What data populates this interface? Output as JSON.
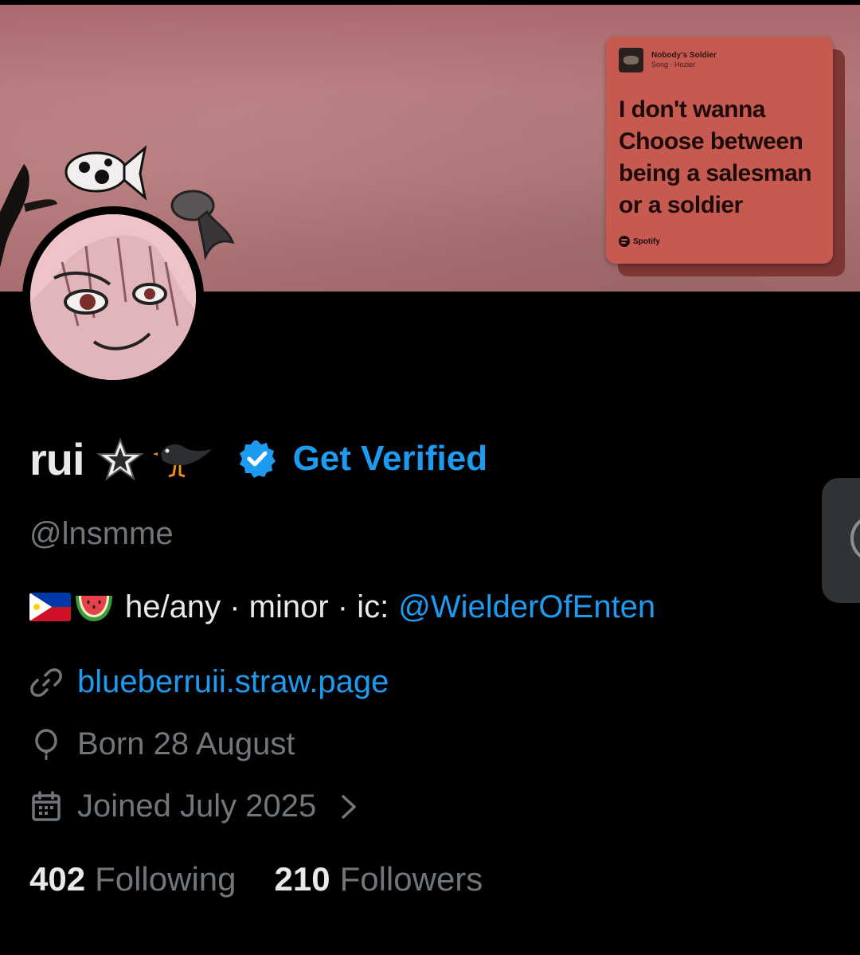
{
  "banner": {
    "song_card": {
      "title": "Nobody's Soldier",
      "subtitle": "Song · Hozier",
      "lyrics": [
        "I don't wanna",
        "Choose between",
        "being a salesman",
        "or a soldier"
      ],
      "brand": "Spotify"
    }
  },
  "profile": {
    "display_name": "rui",
    "name_emojis": [
      "star-icon",
      "black-bird-icon"
    ],
    "get_verified_label": "Get Verified",
    "handle": "@lnsmme",
    "bio": {
      "emojis": [
        "philippines-flag-icon",
        "watermelon-icon"
      ],
      "text": "he/any · minor · ic:",
      "mention": "@WielderOfEnten"
    },
    "website": "blueberruii.straw.page",
    "birthday": "Born 28 August",
    "joined": "Joined July 2025"
  },
  "stats": {
    "following_count": "402",
    "following_label": "Following",
    "followers_count": "210",
    "followers_label": "Followers"
  },
  "colors": {
    "accent": "#1d9bf0",
    "text_primary": "#e7e9ea",
    "text_secondary": "#71767b",
    "background": "#000000",
    "song_card": "#c65a51"
  }
}
